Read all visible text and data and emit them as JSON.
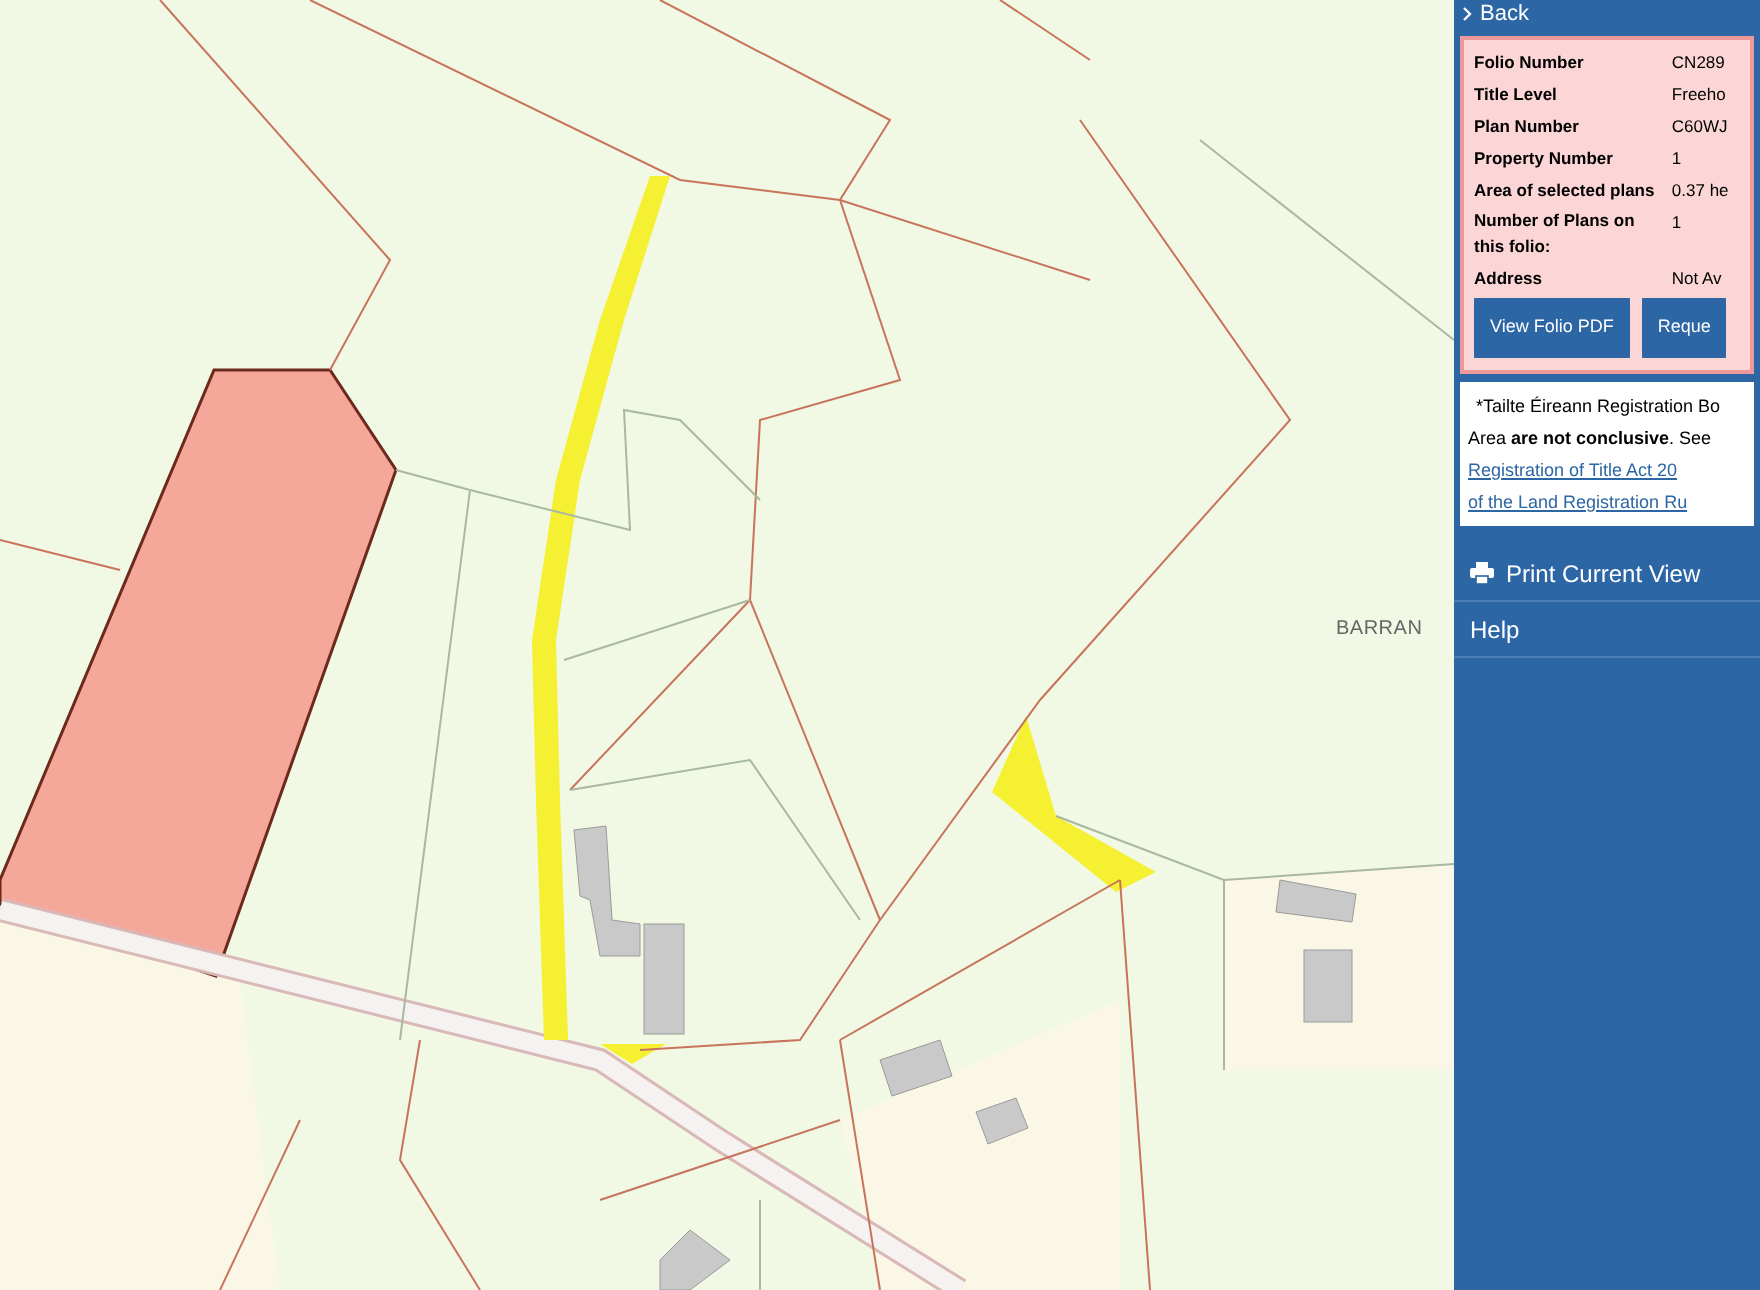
{
  "map": {
    "place_label": "BARRAN"
  },
  "sidebar": {
    "back": "Back",
    "details": [
      {
        "label": "Folio Number",
        "value": "CN289"
      },
      {
        "label": "Title Level",
        "value": "Freeho"
      },
      {
        "label": "Plan Number",
        "value": "C60WJ"
      },
      {
        "label": "Property Number",
        "value": "1"
      },
      {
        "label": "Area of selected plans",
        "value": "0.37 he"
      },
      {
        "label": "Number of Plans on this folio:",
        "value": "1"
      },
      {
        "label": "Address",
        "value": "Not Av"
      }
    ],
    "buttons": [
      "View Folio PDF",
      "Reque"
    ],
    "notice": {
      "lines": [
        "*Tailte Éireann Registration Bo",
        "Area **are not conclusive**. See"
      ],
      "links": [
        "Registration of Title Act 20",
        "of the Land Registration Ru"
      ]
    },
    "menu": [
      {
        "label": "Print Current View",
        "kind": "print"
      },
      {
        "label": "Help",
        "kind": "plain"
      }
    ]
  }
}
